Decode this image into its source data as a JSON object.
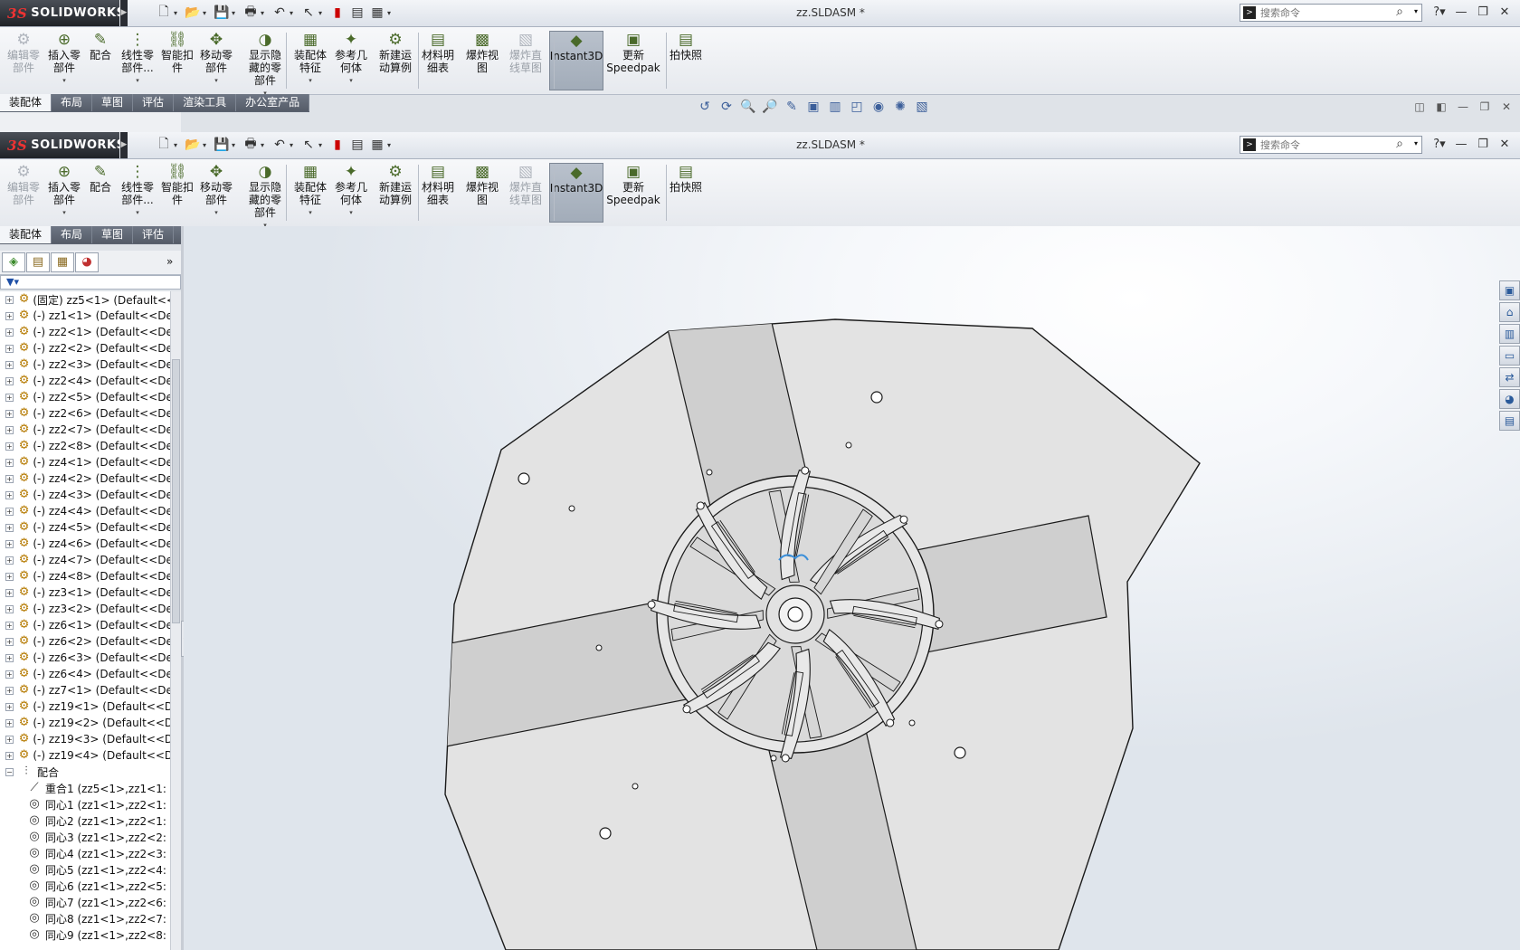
{
  "app": {
    "brand": "SOLIDWORKS",
    "brand_mark": "3S"
  },
  "document": {
    "title": "zz.SLDASM *"
  },
  "search": {
    "placeholder": "搜索命令"
  },
  "ribbon": {
    "buttons": [
      {
        "label1": "编辑零",
        "label2": "部件",
        "disabled": true
      },
      {
        "label1": "插入零",
        "label2": "部件"
      },
      {
        "label1": "配合",
        "label2": ""
      },
      {
        "label1": "线性零",
        "label2": "部件..."
      },
      {
        "label1": "智能扣",
        "label2": "件"
      },
      {
        "label1": "移动零",
        "label2": "部件"
      },
      {
        "label1": "显示隐",
        "label2": "藏的零",
        "label3": "部件"
      },
      {
        "label1": "装配体",
        "label2": "特征"
      },
      {
        "label1": "参考几",
        "label2": "何体"
      },
      {
        "label1": "新建运",
        "label2": "动算例"
      },
      {
        "label1": "材料明",
        "label2": "细表"
      },
      {
        "label1": "爆炸视",
        "label2": "图"
      },
      {
        "label1": "爆炸直",
        "label2": "线草图",
        "disabled": true
      },
      {
        "label1": "Instant3D",
        "label2": ""
      },
      {
        "label1": "更新",
        "label2": "Speedpak"
      },
      {
        "label1": "拍快照",
        "label2": ""
      }
    ]
  },
  "tabs": [
    "装配体",
    "布局",
    "草图",
    "评估",
    "渲染工具",
    "办公室产品"
  ],
  "tree": {
    "components": [
      "(固定) zz5<1> (Default<<",
      "(-) zz1<1> (Default<<De",
      "(-) zz2<1> (Default<<De",
      "(-) zz2<2> (Default<<De",
      "(-) zz2<3> (Default<<De",
      "(-) zz2<4> (Default<<De",
      "(-) zz2<5> (Default<<De",
      "(-) zz2<6> (Default<<De",
      "(-) zz2<7> (Default<<De",
      "(-) zz2<8> (Default<<De",
      "(-) zz4<1> (Default<<De",
      "(-) zz4<2> (Default<<De",
      "(-) zz4<3> (Default<<De",
      "(-) zz4<4> (Default<<De",
      "(-) zz4<5> (Default<<De",
      "(-) zz4<6> (Default<<De",
      "(-) zz4<7> (Default<<De",
      "(-) zz4<8> (Default<<De",
      "(-) zz3<1> (Default<<De",
      "(-) zz3<2> (Default<<De",
      "(-) zz6<1> (Default<<De",
      "(-) zz6<2> (Default<<De",
      "(-) zz6<3> (Default<<De",
      "(-) zz6<4> (Default<<De",
      "(-) zz7<1> (Default<<De",
      "(-) zz19<1> (Default<<D",
      "(-) zz19<2> (Default<<D",
      "(-) zz19<3> (Default<<D",
      "(-) zz19<4> (Default<<D"
    ],
    "mates_folder": "配合",
    "mates": [
      "重合1 (zz5<1>,zz1<1:",
      "同心1 (zz1<1>,zz2<1:",
      "同心2 (zz1<1>,zz2<1:",
      "同心3 (zz1<1>,zz2<2:",
      "同心4 (zz1<1>,zz2<3:",
      "同心5 (zz1<1>,zz2<4:",
      "同心6 (zz1<1>,zz2<5:",
      "同心7 (zz1<1>,zz2<6:",
      "同心8 (zz1<1>,zz2<7:",
      "同心9 (zz1<1>,zz2<8:"
    ]
  },
  "colors": {
    "part_face": "#e2e2e2",
    "part_dark": "#cfcfcf",
    "edge": "#1a1a1a",
    "selection": "#3b8fd9"
  }
}
